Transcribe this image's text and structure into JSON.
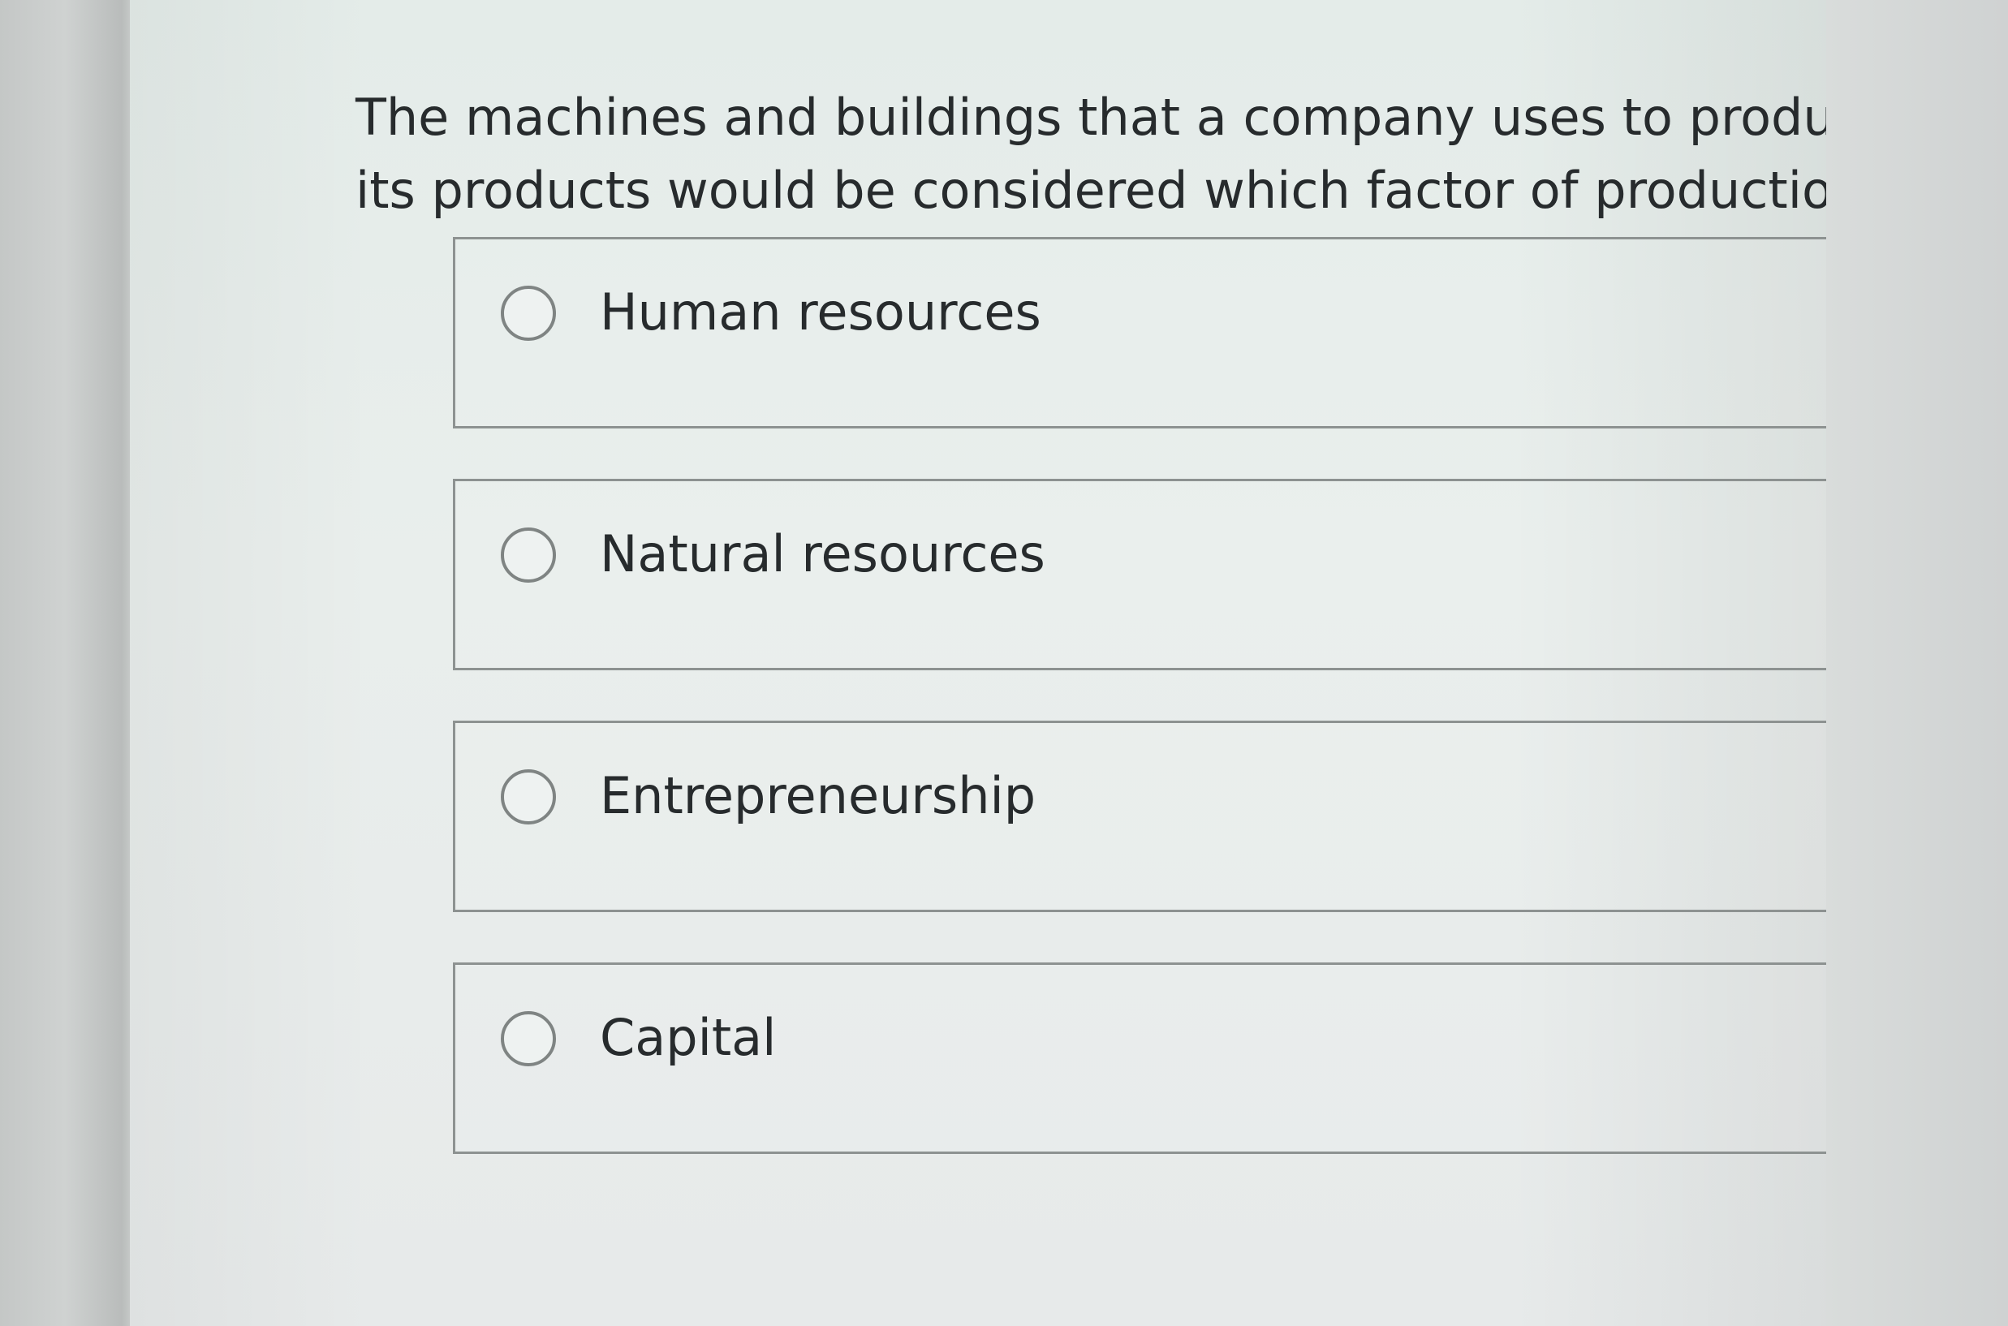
{
  "question": {
    "text": "The machines and buildings that a company uses to produce its products would be considered which factor of production?"
  },
  "options": [
    {
      "label": "Human resources",
      "selected": false
    },
    {
      "label": "Natural resources",
      "selected": false
    },
    {
      "label": "Entrepreneurship",
      "selected": false
    },
    {
      "label": "Capital",
      "selected": false
    }
  ]
}
